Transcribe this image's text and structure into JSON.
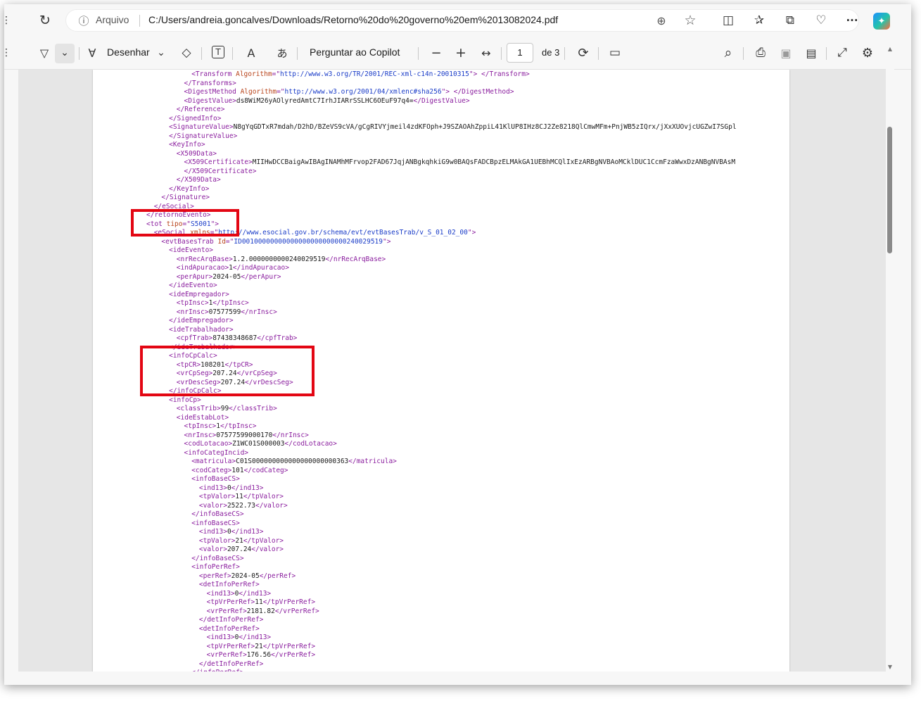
{
  "addressbar": {
    "file_label": "Arquivo",
    "url": "C:/Users/andreia.goncalves/Downloads/Retorno%20do%20governo%20em%2013082024.pdf"
  },
  "toolbar": {
    "draw_label": "Desenhar",
    "ask_copilot": "Perguntar ao Copilot",
    "page_current": "1",
    "page_total": "de 3",
    "zoom_out": "−",
    "zoom_in": "+"
  },
  "glyphs": {
    "refresh": "↻",
    "info": "ⓘ",
    "zoom": "⊕",
    "star": "☆",
    "split": "◫",
    "favs": "✰",
    "collections": "⧉",
    "health": "♡",
    "more": "···",
    "copilot": "✦",
    "sidebar": "⋮",
    "highlight": "▽",
    "chevron": "⌄",
    "draw": "∀",
    "erase": "◇",
    "textbox": "T",
    "readaloud": "A",
    "translate": "あ",
    "fitwidth": "↔",
    "rotate": "⟳",
    "pageview": "▭",
    "search": "⌕",
    "print": "⎙",
    "save": "▣",
    "saveas": "▤",
    "fullscreen": "⤢",
    "settings": "⚙",
    "scroll_up": "▲",
    "scroll_down": "▼"
  },
  "xml_lines": [
    {
      "i": 6,
      "p": [
        [
          "t",
          "<Transform "
        ],
        [
          "a",
          "Algorithm"
        ],
        [
          "t",
          "=\""
        ],
        [
          "v",
          "http://www.w3.org/TR/2001/REC-xml-c14n-20010315"
        ],
        [
          "t",
          "\"> </Transform>"
        ]
      ]
    },
    {
      "i": 5,
      "p": [
        [
          "t",
          "</Transforms>"
        ]
      ]
    },
    {
      "i": 5,
      "p": [
        [
          "t",
          "<DigestMethod "
        ],
        [
          "a",
          "Algorithm"
        ],
        [
          "t",
          "=\""
        ],
        [
          "v",
          "http://www.w3.org/2001/04/xmlenc#sha256"
        ],
        [
          "t",
          "\"> </DigestMethod>"
        ]
      ]
    },
    {
      "i": 5,
      "p": [
        [
          "t",
          "<DigestValue>"
        ],
        [
          "x",
          "ds8WiM26yAOlyredAmtC7IrhJIARrSSLHC6OEuF97q4="
        ],
        [
          "t",
          "</DigestValue>"
        ]
      ]
    },
    {
      "i": 4,
      "p": [
        [
          "t",
          "</Reference>"
        ]
      ]
    },
    {
      "i": 3,
      "p": [
        [
          "t",
          "</SignedInfo>"
        ]
      ]
    },
    {
      "i": 3,
      "p": [
        [
          "t",
          "<SignatureValue>"
        ],
        [
          "x",
          "N8gYqGDTxR7mdah/D2hD/BZeVS9cVA/gCgRIVYjmeil4zdKFOph+J9SZAOAhZppiL41KlUP8IHz8CJ2Ze8218QlCmwMFm+PnjWB5zIQrx/jXxXUOvjcUGZwI7SGpl"
        ]
      ]
    },
    {
      "i": 3,
      "p": [
        [
          "t",
          "</SignatureValue>"
        ]
      ]
    },
    {
      "i": 3,
      "p": [
        [
          "t",
          "<KeyInfo>"
        ]
      ]
    },
    {
      "i": 4,
      "p": [
        [
          "t",
          "<X509Data>"
        ]
      ]
    },
    {
      "i": 5,
      "p": [
        [
          "t",
          "<X509Certificate>"
        ],
        [
          "x",
          "MIIHwDCCBaigAwIBAgINAMhMFrvop2FAD67JqjANBgkqhkiG9w0BAQsFADCBpzELMAkGA1UEBhMCQlIxEzARBgNVBAoMCklDUC1CcmFzaWwxDzANBgNVBAsM"
        ]
      ]
    },
    {
      "i": 5,
      "p": [
        [
          "t",
          "</X509Certificate>"
        ]
      ]
    },
    {
      "i": 4,
      "p": [
        [
          "t",
          "</X509Data>"
        ]
      ]
    },
    {
      "i": 3,
      "p": [
        [
          "t",
          "</KeyInfo>"
        ]
      ]
    },
    {
      "i": 2,
      "p": [
        [
          "t",
          "</Signature>"
        ]
      ]
    },
    {
      "i": 1,
      "p": [
        [
          "t",
          "</eSocial>"
        ]
      ]
    },
    {
      "i": 0,
      "p": [
        [
          "t",
          "</retornoEvento>"
        ]
      ]
    },
    {
      "i": 0,
      "p": [
        [
          "t",
          "<tot "
        ],
        [
          "a",
          "tipo"
        ],
        [
          "t",
          "=\""
        ],
        [
          "v",
          "S5001"
        ],
        [
          "t",
          "\">"
        ]
      ]
    },
    {
      "i": 1,
      "p": [
        [
          "t",
          "<eSocial "
        ],
        [
          "a",
          "xmlns"
        ],
        [
          "t",
          "=\""
        ],
        [
          "v",
          "http://www.esocial.gov.br/schema/evt/evtBasesTrab/v_S_01_02_00"
        ],
        [
          "t",
          "\">"
        ]
      ]
    },
    {
      "i": 2,
      "p": [
        [
          "t",
          "<evtBasesTrab "
        ],
        [
          "a",
          "Id"
        ],
        [
          "t",
          "=\""
        ],
        [
          "v",
          "ID00100000000000000000000000240029519"
        ],
        [
          "t",
          "\">"
        ]
      ]
    },
    {
      "i": 3,
      "p": [
        [
          "t",
          "<ideEvento>"
        ]
      ]
    },
    {
      "i": 4,
      "p": [
        [
          "t",
          "<nrRecArqBase>"
        ],
        [
          "x",
          "1.2.0000000000240029519"
        ],
        [
          "t",
          "</nrRecArqBase>"
        ]
      ]
    },
    {
      "i": 4,
      "p": [
        [
          "t",
          "<indApuracao>"
        ],
        [
          "x",
          "1"
        ],
        [
          "t",
          "</indApuracao>"
        ]
      ]
    },
    {
      "i": 4,
      "p": [
        [
          "t",
          "<perApur>"
        ],
        [
          "x",
          "2024-05"
        ],
        [
          "t",
          "</perApur>"
        ]
      ]
    },
    {
      "i": 3,
      "p": [
        [
          "t",
          "</ideEvento>"
        ]
      ]
    },
    {
      "i": 3,
      "p": [
        [
          "t",
          "<ideEmpregador>"
        ]
      ]
    },
    {
      "i": 4,
      "p": [
        [
          "t",
          "<tpInsc>"
        ],
        [
          "x",
          "1"
        ],
        [
          "t",
          "</tpInsc>"
        ]
      ]
    },
    {
      "i": 4,
      "p": [
        [
          "t",
          "<nrInsc>"
        ],
        [
          "x",
          "07577599"
        ],
        [
          "t",
          "</nrInsc>"
        ]
      ]
    },
    {
      "i": 3,
      "p": [
        [
          "t",
          "</ideEmpregador>"
        ]
      ]
    },
    {
      "i": 3,
      "p": [
        [
          "t",
          "<ideTrabalhador>"
        ]
      ]
    },
    {
      "i": 4,
      "p": [
        [
          "t",
          "<cpfTrab>"
        ],
        [
          "x",
          "87438348687"
        ],
        [
          "t",
          "</cpfTrab>"
        ]
      ]
    },
    {
      "i": 3,
      "p": [
        [
          "t",
          "</ideTrabalhador>"
        ]
      ]
    },
    {
      "i": 3,
      "p": [
        [
          "t",
          "<infoCpCalc>"
        ]
      ]
    },
    {
      "i": 4,
      "p": [
        [
          "t",
          "<tpCR>"
        ],
        [
          "x",
          "108201"
        ],
        [
          "t",
          "</tpCR>"
        ]
      ]
    },
    {
      "i": 4,
      "p": [
        [
          "t",
          "<vrCpSeg>"
        ],
        [
          "x",
          "207.24"
        ],
        [
          "t",
          "</vrCpSeg>"
        ]
      ]
    },
    {
      "i": 4,
      "p": [
        [
          "t",
          "<vrDescSeg>"
        ],
        [
          "x",
          "207.24"
        ],
        [
          "t",
          "</vrDescSeg>"
        ]
      ]
    },
    {
      "i": 3,
      "p": [
        [
          "t",
          "</infoCpCalc>"
        ]
      ]
    },
    {
      "i": 3,
      "p": [
        [
          "t",
          "<infoCp>"
        ]
      ]
    },
    {
      "i": 4,
      "p": [
        [
          "t",
          "<classTrib>"
        ],
        [
          "x",
          "99"
        ],
        [
          "t",
          "</classTrib>"
        ]
      ]
    },
    {
      "i": 4,
      "p": [
        [
          "t",
          "<ideEstabLot>"
        ]
      ]
    },
    {
      "i": 5,
      "p": [
        [
          "t",
          "<tpInsc>"
        ],
        [
          "x",
          "1"
        ],
        [
          "t",
          "</tpInsc>"
        ]
      ]
    },
    {
      "i": 5,
      "p": [
        [
          "t",
          "<nrInsc>"
        ],
        [
          "x",
          "07577599000170"
        ],
        [
          "t",
          "</nrInsc>"
        ]
      ]
    },
    {
      "i": 5,
      "p": [
        [
          "t",
          "<codLotacao>"
        ],
        [
          "x",
          "Z1WC01S000003"
        ],
        [
          "t",
          "</codLotacao>"
        ]
      ]
    },
    {
      "i": 5,
      "p": [
        [
          "t",
          "<infoCategIncid>"
        ]
      ]
    },
    {
      "i": 6,
      "p": [
        [
          "t",
          "<matricula>"
        ],
        [
          "x",
          "C01S000000000000000000000363"
        ],
        [
          "t",
          "</matricula>"
        ]
      ]
    },
    {
      "i": 6,
      "p": [
        [
          "t",
          "<codCateg>"
        ],
        [
          "x",
          "101"
        ],
        [
          "t",
          "</codCateg>"
        ]
      ]
    },
    {
      "i": 6,
      "p": [
        [
          "t",
          "<infoBaseCS>"
        ]
      ]
    },
    {
      "i": 7,
      "p": [
        [
          "t",
          "<ind13>"
        ],
        [
          "x",
          "0"
        ],
        [
          "t",
          "</ind13>"
        ]
      ]
    },
    {
      "i": 7,
      "p": [
        [
          "t",
          "<tpValor>"
        ],
        [
          "x",
          "11"
        ],
        [
          "t",
          "</tpValor>"
        ]
      ]
    },
    {
      "i": 7,
      "p": [
        [
          "t",
          "<valor>"
        ],
        [
          "x",
          "2522.73"
        ],
        [
          "t",
          "</valor>"
        ]
      ]
    },
    {
      "i": 6,
      "p": [
        [
          "t",
          "</infoBaseCS>"
        ]
      ]
    },
    {
      "i": 6,
      "p": [
        [
          "t",
          "<infoBaseCS>"
        ]
      ]
    },
    {
      "i": 7,
      "p": [
        [
          "t",
          "<ind13>"
        ],
        [
          "x",
          "0"
        ],
        [
          "t",
          "</ind13>"
        ]
      ]
    },
    {
      "i": 7,
      "p": [
        [
          "t",
          "<tpValor>"
        ],
        [
          "x",
          "21"
        ],
        [
          "t",
          "</tpValor>"
        ]
      ]
    },
    {
      "i": 7,
      "p": [
        [
          "t",
          "<valor>"
        ],
        [
          "x",
          "207.24"
        ],
        [
          "t",
          "</valor>"
        ]
      ]
    },
    {
      "i": 6,
      "p": [
        [
          "t",
          "</infoBaseCS>"
        ]
      ]
    },
    {
      "i": 6,
      "p": [
        [
          "t",
          "<infoPerRef>"
        ]
      ]
    },
    {
      "i": 7,
      "p": [
        [
          "t",
          "<perRef>"
        ],
        [
          "x",
          "2024-05"
        ],
        [
          "t",
          "</perRef>"
        ]
      ]
    },
    {
      "i": 7,
      "p": [
        [
          "t",
          "<detInfoPerRef>"
        ]
      ]
    },
    {
      "i": 8,
      "p": [
        [
          "t",
          "<ind13>"
        ],
        [
          "x",
          "0"
        ],
        [
          "t",
          "</ind13>"
        ]
      ]
    },
    {
      "i": 8,
      "p": [
        [
          "t",
          "<tpVrPerRef>"
        ],
        [
          "x",
          "11"
        ],
        [
          "t",
          "</tpVrPerRef>"
        ]
      ]
    },
    {
      "i": 8,
      "p": [
        [
          "t",
          "<vrPerRef>"
        ],
        [
          "x",
          "2181.82"
        ],
        [
          "t",
          "</vrPerRef>"
        ]
      ]
    },
    {
      "i": 7,
      "p": [
        [
          "t",
          "</detInfoPerRef>"
        ]
      ]
    },
    {
      "i": 7,
      "p": [
        [
          "t",
          "<detInfoPerRef>"
        ]
      ]
    },
    {
      "i": 8,
      "p": [
        [
          "t",
          "<ind13>"
        ],
        [
          "x",
          "0"
        ],
        [
          "t",
          "</ind13>"
        ]
      ]
    },
    {
      "i": 8,
      "p": [
        [
          "t",
          "<tpVrPerRef>"
        ],
        [
          "x",
          "21"
        ],
        [
          "t",
          "</tpVrPerRef>"
        ]
      ]
    },
    {
      "i": 8,
      "p": [
        [
          "t",
          "<vrPerRef>"
        ],
        [
          "x",
          "176.56"
        ],
        [
          "t",
          "</vrPerRef>"
        ]
      ]
    },
    {
      "i": 7,
      "p": [
        [
          "t",
          "</detInfoPerRef>"
        ]
      ]
    },
    {
      "i": 6,
      "p": [
        [
          "t",
          "</infoPerRef>"
        ]
      ]
    }
  ]
}
